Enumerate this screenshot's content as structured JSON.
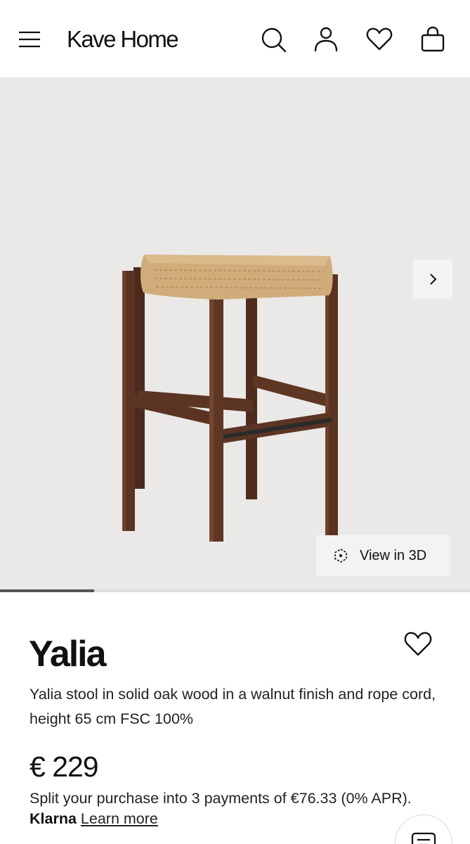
{
  "header": {
    "brand": "Kave Home",
    "icons": [
      "menu-icon",
      "search-icon",
      "account-icon",
      "wishlist-icon",
      "cart-icon"
    ]
  },
  "gallery": {
    "view_3d_label": "View in 3D",
    "slide_progress": 0.2,
    "icons": [
      "chevron-right-icon",
      "3d-cube-icon"
    ]
  },
  "product": {
    "name": "Yalia",
    "description": "Yalia stool in solid oak wood in a walnut finish and rope cord, height 65 cm FSC 100%",
    "price": "€ 229",
    "klarna_text": "Split your purchase into 3 payments of €76.33 (0% APR).",
    "klarna_brand": "Klarna",
    "learn_more": "Learn more"
  },
  "colors": {
    "gallery_bg": "#ebe9e7",
    "button_bg": "#f4f3f1",
    "progress_track": "#dcdcdc",
    "progress_fill": "#555555",
    "wood": "#5a3322",
    "rope": "#cfac7a"
  }
}
